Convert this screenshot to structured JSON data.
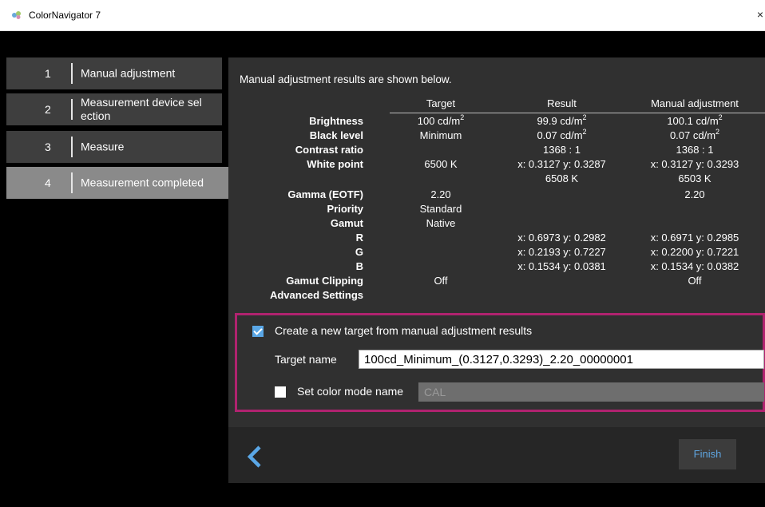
{
  "window": {
    "title": "ColorNavigator 7",
    "close_glyph": "×"
  },
  "steps": [
    {
      "num": "1",
      "label": "Manual adjustment",
      "active": false
    },
    {
      "num": "2",
      "label": "Measurement device sel ection",
      "active": false
    },
    {
      "num": "3",
      "label": "Measure",
      "active": false
    },
    {
      "num": "4",
      "label": "Measurement completed",
      "active": true
    }
  ],
  "panel": {
    "intro": "Manual adjustment results are shown below.",
    "columns": {
      "target": "Target",
      "result": "Result",
      "manual": "Manual adjustment"
    },
    "rows": {
      "brightness": {
        "label": "Brightness",
        "target": "100 cd/m",
        "target_sup": "2",
        "result": "99.9 cd/m",
        "result_sup": "2",
        "manual": "100.1 cd/m",
        "manual_sup": "2"
      },
      "black": {
        "label": "Black level",
        "target": "Minimum",
        "result": "0.07 cd/m",
        "result_sup": "2",
        "manual": "0.07 cd/m",
        "manual_sup": "2"
      },
      "contrast": {
        "label": "Contrast ratio",
        "result": "1368 : 1",
        "manual": "1368 : 1"
      },
      "white": {
        "label": "White point",
        "target": "6500 K",
        "result": "x: 0.3127  y: 0.3287",
        "manual": "x: 0.3127  y: 0.3293"
      },
      "white_k": {
        "result": "6508 K",
        "manual": "6503 K"
      },
      "gamma": {
        "label": "Gamma (EOTF)",
        "target": "2.20",
        "manual": "2.20"
      },
      "priority": {
        "label": "Priority",
        "target": "Standard"
      },
      "gamut": {
        "label": "Gamut",
        "target": "Native"
      },
      "r": {
        "label": "R",
        "result": "x: 0.6973  y: 0.2982",
        "manual": "x: 0.6971  y: 0.2985"
      },
      "g": {
        "label": "G",
        "result": "x: 0.2193  y: 0.7227",
        "manual": "x: 0.2200  y: 0.7221"
      },
      "b": {
        "label": "B",
        "result": "x: 0.1534  y: 0.0381",
        "manual": "x: 0.1534  y: 0.0382"
      },
      "clipping": {
        "label": "Gamut Clipping",
        "target": "Off",
        "manual": "Off"
      },
      "advanced": {
        "label": "Advanced Settings"
      }
    },
    "new_target": {
      "checkbox_label": "Create a new target from manual adjustment results",
      "checked": true,
      "target_name_label": "Target name",
      "target_name_value": "100cd_Minimum_(0.3127,0.3293)_2.20_00000001",
      "color_mode_label": "Set color mode name",
      "color_mode_checked": false,
      "color_mode_value": "CAL"
    },
    "footer": {
      "finish_label": "Finish"
    }
  },
  "colors": {
    "accent": "#5aa7e6",
    "highlight_border": "#b0236f",
    "active_step": "#8a8a8a"
  }
}
